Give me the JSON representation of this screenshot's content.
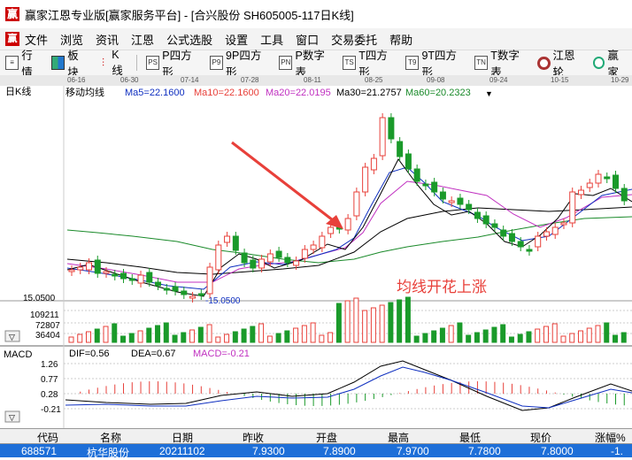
{
  "window": {
    "logo_glyph": "赢",
    "title": "赢家江恩专业版[赢家服务平台] - [合兴股份  SH605005-117日K线]"
  },
  "menu": {
    "logo_glyph": "赢",
    "items": [
      "文件",
      "浏览",
      "资讯",
      "江恩",
      "公式选股",
      "设置",
      "工具",
      "窗口",
      "交易委托",
      "帮助"
    ]
  },
  "toolbar": {
    "items": [
      {
        "label": "行情",
        "icon": "list-icon"
      },
      {
        "label": "板块",
        "icon": "grid-icon"
      },
      {
        "label": "K线",
        "icon": "kline-icon"
      },
      {
        "label": "P四方形",
        "icon": "ps-icon",
        "glyph": "PS"
      },
      {
        "label": "9P四方形",
        "icon": "p9-icon",
        "glyph": "P9"
      },
      {
        "label": "P数字表",
        "icon": "pn-icon",
        "glyph": "PN"
      },
      {
        "label": "T四方形",
        "icon": "ts-icon",
        "glyph": "TS"
      },
      {
        "label": "9T四方形",
        "icon": "t9-icon",
        "glyph": "T9"
      },
      {
        "label": "T数字表",
        "icon": "tn-icon",
        "glyph": "TN"
      },
      {
        "label": "江恩轮",
        "icon": "gann-wheel-icon"
      },
      {
        "label": "赢家",
        "icon": "yingjia-icon"
      }
    ]
  },
  "date_axis": [
    "06-16",
    "06-30",
    "07-14",
    "07-28",
    "08-11",
    "08-25",
    "09-08",
    "09-24",
    "10-15",
    "10-29"
  ],
  "kline_panel": {
    "label": "日K线",
    "indicator": "移动均线",
    "ma5": "Ma5=22.1600",
    "ma10": "Ma10=22.1600",
    "ma20": "Ma20=22.0195",
    "ma30": "Ma30=21.2757",
    "ma60": "Ma60=20.2323",
    "low_price": "15.0500",
    "low_mark": "-15.0500",
    "annotation": "均线开花上涨"
  },
  "volume_panel": {
    "ticks": [
      "109211",
      "72807",
      "36404"
    ]
  },
  "macd_panel": {
    "label": "MACD",
    "dif": "DIF=0.56",
    "dea": "DEA=0.67",
    "macd": "MACD=-0.21",
    "ticks": [
      "1.26",
      "0.77",
      "0.28",
      "-0.21"
    ]
  },
  "colors": {
    "up": "#e8403a",
    "down": "#1a9a2a",
    "ma5": "#000000",
    "ma10": "#1030c0",
    "ma20": "#c030c0",
    "ma30": "#000000",
    "ma60": "#1a8a2a",
    "grid": "#cccccc",
    "selected_row": "#1e6fd8"
  },
  "table": {
    "headers": [
      "代码",
      "名称",
      "日期",
      "昨收",
      "开盘",
      "最高",
      "最低",
      "现价",
      "涨幅%"
    ],
    "row": [
      "688571",
      "杭华股份",
      "20211102",
      "7.9300",
      "7.8900",
      "7.9700",
      "7.7800",
      "7.8000",
      "-1."
    ]
  },
  "chart_data": {
    "type": "candlestick",
    "x_range": [
      "06-16",
      "11-02"
    ],
    "y_range": [
      15.05,
      28.5
    ],
    "volume_ticks": [
      36404,
      72807,
      109211
    ],
    "macd_ticks": [
      -0.21,
      0.28,
      0.77,
      1.26
    ]
  }
}
